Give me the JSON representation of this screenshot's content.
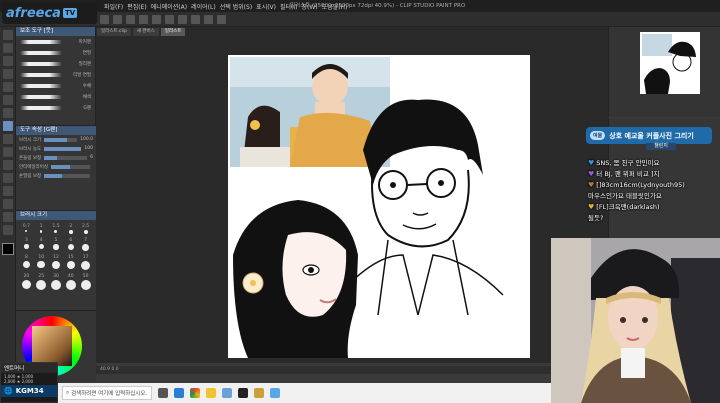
{
  "stream": {
    "logo_text": "afreeca",
    "logo_tv": "TV"
  },
  "window_title": "일러스트 (2500 x 2500px 72dpi 40.9%) - CLIP STUDIO PAINT PRO",
  "menu": [
    "파일(F)",
    "편집(E)",
    "애니메이션(A)",
    "레이어(L)",
    "선택 범위(S)",
    "표시(V)",
    "필터(I)",
    "창(W)",
    "도움말(H)"
  ],
  "canvas_tabs": [
    "일러스트.clip",
    "새 캔버스",
    "일러스트"
  ],
  "subtool": {
    "title": "보조 도구 [붓]",
    "brushes": [
      "마커펜",
      "연필",
      "밀리펜",
      "리얼 연필",
      "수채",
      "채색",
      "G펜"
    ]
  },
  "tool_property": {
    "title": "도구 속성 [G펜]",
    "rows": [
      {
        "label": "브러시 크기",
        "value": "100.0",
        "level": 0.7
      },
      {
        "label": "브러시 농도",
        "value": "100",
        "level": 1.0
      },
      {
        "label": "흔들림 보정",
        "value": "6",
        "level": 0.3
      },
      {
        "label": "안티에일리어싱",
        "value": "",
        "level": 0.5
      },
      {
        "label": "손떨림 보정",
        "value": "",
        "level": 0.4
      }
    ]
  },
  "brush_size": {
    "title": "브러시 크기",
    "sizes": [
      "0.7",
      "1",
      "1.5",
      "2",
      "2.5",
      "3",
      "4",
      "5",
      "6",
      "7",
      "8",
      "10",
      "12",
      "15",
      "17",
      "20",
      "25",
      "30",
      "40",
      "50"
    ]
  },
  "status_bar": "40.9  0.0",
  "badge": {
    "title": "엔트머니",
    "line1": "1,000 ★ 1,000",
    "line2": "2,000 ★ 2,000",
    "name": "KGM34"
  },
  "chat": {
    "tag": "여울",
    "title": "상호 예교울 커플사진 그리기",
    "subtab": "챌린지",
    "lines": [
      {
        "heart": "💙",
        "color": "#3d8be0",
        "text": "SNS, 몸 친구 안민이요"
      },
      {
        "heart": "💜",
        "color": "#9b59d0",
        "text": "터 BJ, 팬 뷔퍼 비교 ]지"
      },
      {
        "heart": "🤎",
        "color": "#b07a3f",
        "text": "[]83cm16cm(Lydnyouth95)"
      },
      {
        "heart": "",
        "color": "#ffffff",
        "text": "마우스인가요 태블릿인가요"
      },
      {
        "heart": "💛",
        "color": "#d9b23a",
        "text": "[FL]크윽맨(darklash)"
      },
      {
        "heart": "",
        "color": "#ffffff",
        "text": "될듯?"
      }
    ]
  },
  "taskbar": {
    "search_placeholder": "검색하려면 여기에 입력하십시오."
  }
}
